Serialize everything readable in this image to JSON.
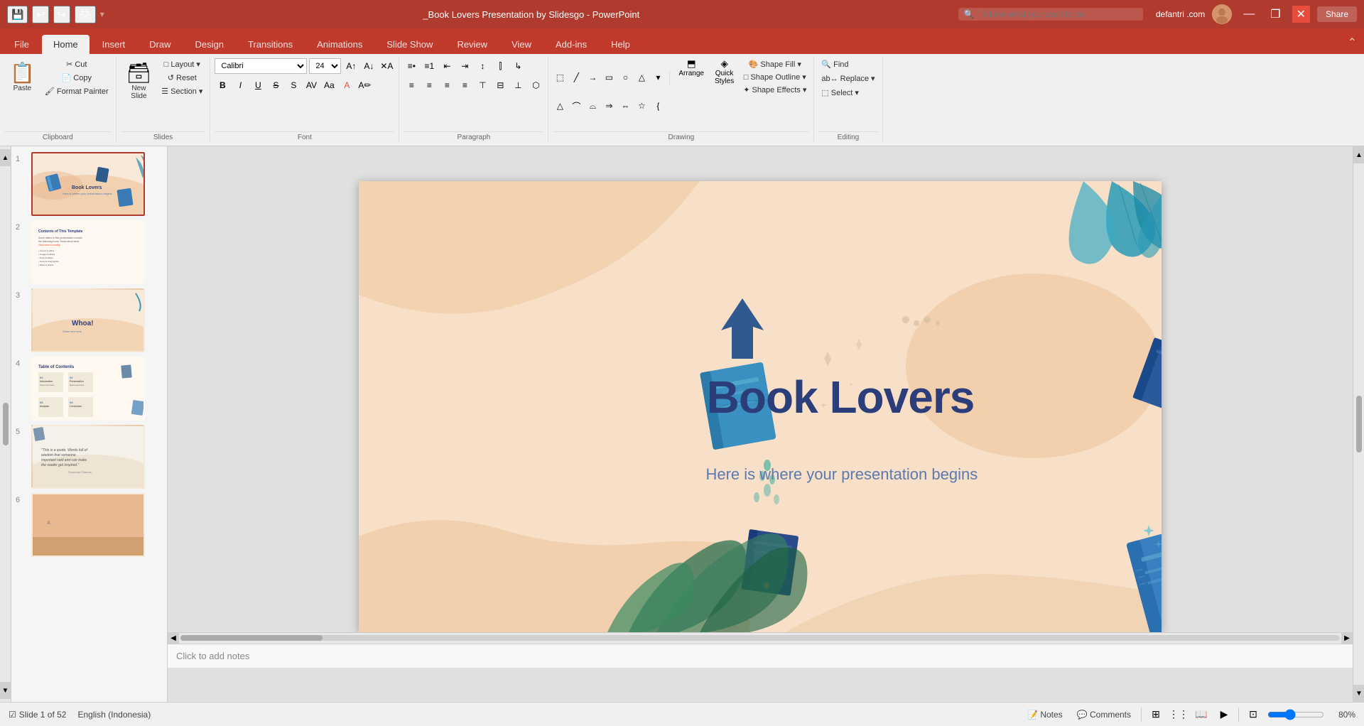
{
  "titleBar": {
    "title": "_Book Lovers Presentation by Slidesgo - PowerPoint",
    "user": "defantri .com",
    "windowBtns": [
      "—",
      "❐",
      "✕"
    ]
  },
  "quickAccess": {
    "icons": [
      "💾",
      "↩",
      "↪",
      "🖨",
      "↩"
    ]
  },
  "tabs": [
    {
      "label": "File",
      "active": false
    },
    {
      "label": "Home",
      "active": true
    },
    {
      "label": "Insert",
      "active": false
    },
    {
      "label": "Draw",
      "active": false
    },
    {
      "label": "Design",
      "active": false
    },
    {
      "label": "Transitions",
      "active": false
    },
    {
      "label": "Animations",
      "active": false
    },
    {
      "label": "Slide Show",
      "active": false
    },
    {
      "label": "Review",
      "active": false
    },
    {
      "label": "View",
      "active": false
    },
    {
      "label": "Add-ins",
      "active": false
    },
    {
      "label": "Help",
      "active": false
    }
  ],
  "ribbon": {
    "clipboard": {
      "label": "Clipboard",
      "paste": "Paste",
      "cut": "Cut",
      "copy": "Copy",
      "formatPainter": "Format Painter"
    },
    "slides": {
      "label": "Slides",
      "newSlide": "New Slide",
      "layout": "Layout",
      "reset": "Reset",
      "section": "Section"
    },
    "font": {
      "label": "Font",
      "fontName": "Calibri",
      "fontSize": "24",
      "bold": "B",
      "italic": "I",
      "underline": "U",
      "strikethrough": "S",
      "increase": "A↑",
      "decrease": "A↓"
    },
    "paragraph": {
      "label": "Paragraph"
    },
    "drawing": {
      "label": "Drawing",
      "arrange": "Arrange",
      "quickStyles": "Quick Styles",
      "shapeFill": "Shape Fill",
      "shapeOutline": "Shape Outline",
      "shapeEffects": "Shape Effects"
    },
    "editing": {
      "label": "Editing",
      "find": "Find",
      "replace": "Replace",
      "select": "Select"
    }
  },
  "slides": [
    {
      "num": "1",
      "active": true,
      "type": "title"
    },
    {
      "num": "2",
      "active": false,
      "type": "content"
    },
    {
      "num": "3",
      "active": false,
      "type": "title2"
    },
    {
      "num": "4",
      "active": false,
      "type": "toc"
    },
    {
      "num": "5",
      "active": false,
      "type": "quote"
    },
    {
      "num": "6",
      "active": false,
      "type": "accent"
    }
  ],
  "currentSlide": {
    "title": "Book Lovers",
    "subtitle": "Here is where your presentation begins"
  },
  "statusBar": {
    "slideInfo": "Slide 1 of 52",
    "language": "English (Indonesia)",
    "notes": "Notes",
    "comments": "Comments",
    "zoom": "80%"
  },
  "notes": {
    "placeholder": "Click to add notes"
  },
  "searchBar": {
    "placeholder": "Tell me what you want to do"
  },
  "share": {
    "label": "Share"
  }
}
